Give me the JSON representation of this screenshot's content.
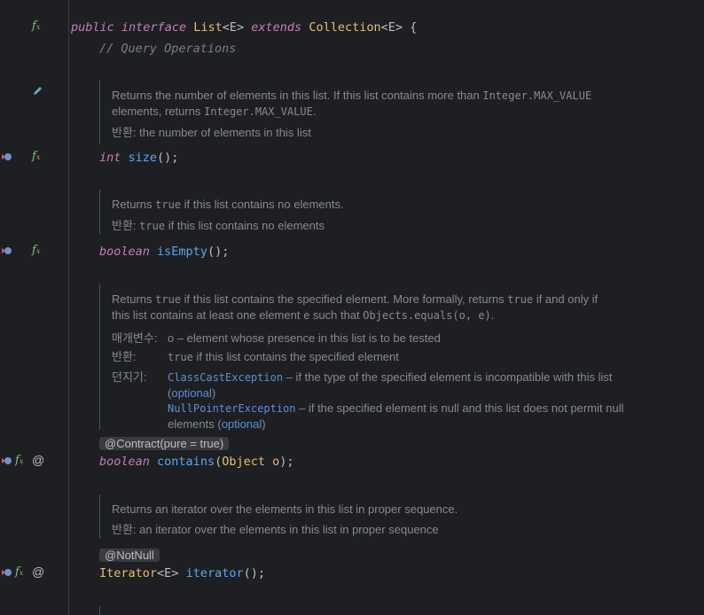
{
  "header": {
    "kw_public": "public",
    "kw_interface": "interface",
    "type_list": "List",
    "generic_open": "<E>",
    "kw_extends": "extends",
    "type_collection": "Collection",
    "generic_e": "<E>",
    "brace": "{"
  },
  "comment_query": "// Query Operations",
  "size_doc": {
    "line1_pre": "Returns the number of elements in this list. If this list contains more than ",
    "line1_code": "Integer.MAX_VALUE",
    "line2_pre": "elements, returns ",
    "line2_code": "Integer.MAX_VALUE",
    "line2_post": ".",
    "returns_label": "반환:",
    "returns_text": "the number of elements in this list"
  },
  "size_decl": {
    "kw": "int",
    "name": "size",
    "rest": "();"
  },
  "isEmpty_doc": {
    "line1_pre": "Returns ",
    "line1_code": "true",
    "line1_post": " if this list contains no elements.",
    "returns_label": "반환:",
    "returns_code": "true",
    "returns_text": " if this list contains no elements"
  },
  "isEmpty_decl": {
    "kw": "boolean",
    "name": "isEmpty",
    "rest": "();"
  },
  "contains_doc": {
    "line1_a": "Returns ",
    "line1_code1": "true",
    "line1_b": " if this list contains the specified element. More formally, returns ",
    "line1_code2": "true",
    "line1_c": " if and only if",
    "line2_a": "this list contains at least one element ",
    "line2_code1": "e",
    "line2_b": " such that ",
    "line2_code2": "Objects.equals(o, e)",
    "line2_c": ".",
    "params_label": "매개변수:",
    "params_text": "o – element whose presence in this list is to be tested",
    "returns_label": "반환:",
    "returns_code": "true",
    "returns_text": " if this list contains the specified element",
    "throws_label": "던지기:",
    "throw1_code": "ClassCastException",
    "throw1_text": " – if the type of the specified element is incompatible with this list",
    "throw1_paren_open": "(",
    "throw1_link": "optional",
    "throw1_paren_close": ")",
    "throw2_code": "NullPointerException",
    "throw2_text": " – if the specified element is null and this list does not permit null",
    "throw2_text2": "elements (",
    "throw2_link": "optional",
    "throw2_close": ")"
  },
  "contains_anno": "@Contract(pure = true)",
  "contains_decl": {
    "kw": "boolean",
    "name": "contains",
    "paren_open": "(",
    "type": "Object",
    "param": " o",
    "rest": ");"
  },
  "iterator_doc": {
    "line1": "Returns an iterator over the elements in this list in proper sequence.",
    "returns_label": "반환:",
    "returns_text": "an iterator over the elements in this list in proper sequence"
  },
  "iterator_anno": "@NotNull",
  "iterator_decl": {
    "type": "Iterator",
    "generic": "<E>",
    "name": "iterator",
    "rest": "();"
  },
  "gutter": {
    "fx": "f",
    "fx_sub": "x",
    "at": "@"
  }
}
